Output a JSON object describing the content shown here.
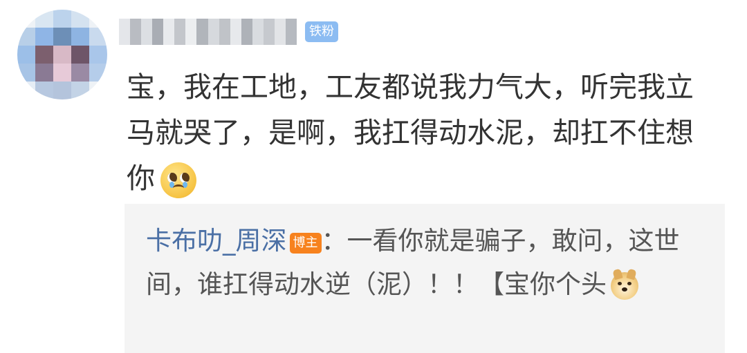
{
  "comment": {
    "username_redacted": true,
    "fan_badge": "铁粉",
    "text": "宝，我在工地，工友都说我力气大，听完我立马就哭了，是啊，我扛得动水泥，却扛不住想你",
    "emoji": "pleading-face-icon"
  },
  "reply": {
    "author": "卡布叻_周深",
    "host_badge": "博主",
    "text": "：一看你就是骗子，敢问，这世间，谁扛得动水逆（泥）！！【宝你个头",
    "emoji": "doge-icon"
  },
  "colors": {
    "fan_badge_bg": "#8cbcf2",
    "host_badge_bg": "#f7821e",
    "author_link": "#4a6fa5",
    "reply_bg": "#f4f4f4"
  }
}
